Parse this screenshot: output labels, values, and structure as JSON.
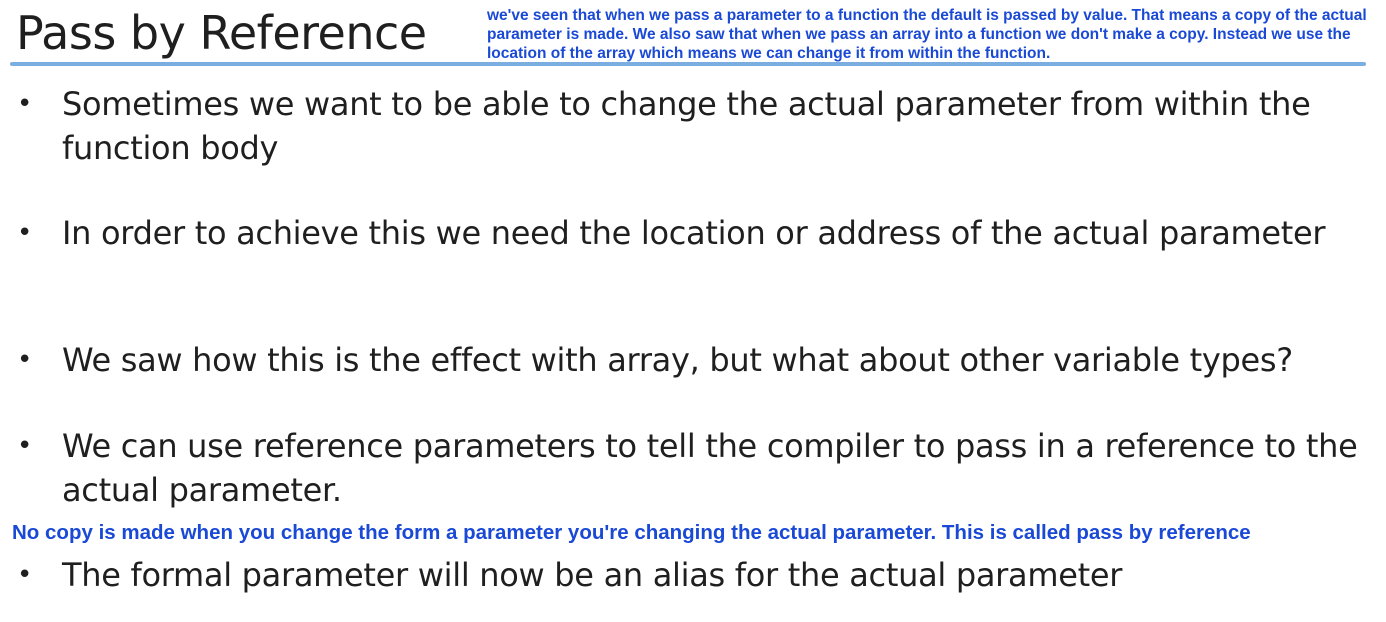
{
  "slide": {
    "title": "Pass by Reference",
    "annotation_top": "we've seen that when we pass a parameter to a function the default is passed by value. That means a copy of the actual parameter is made. We also saw that when we pass an array into a function we don't make a copy. Instead we use the location of the array which means we can change it from within the function.",
    "annotation_mid": "No copy is made when you change the form a parameter you're changing the actual parameter. This is called pass by reference",
    "bullet_symbol": "•",
    "bullets": [
      {
        "text": "Sometimes we want to be able to change the actual parameter from within the function body"
      },
      {
        "text": "In order to achieve this we need the location or address of the actual parameter"
      },
      {
        "text": "We saw how this is the effect with array, but what about other variable types?"
      },
      {
        "text": "We can use reference parameters to tell the compiler to pass in a reference to the actual parameter."
      },
      {
        "text": "The formal parameter will now be an alias for the actual parameter"
      }
    ]
  },
  "colors": {
    "annotation": "#1a49d6",
    "rule": "#7aaee0",
    "text": "#1f1f1f"
  }
}
